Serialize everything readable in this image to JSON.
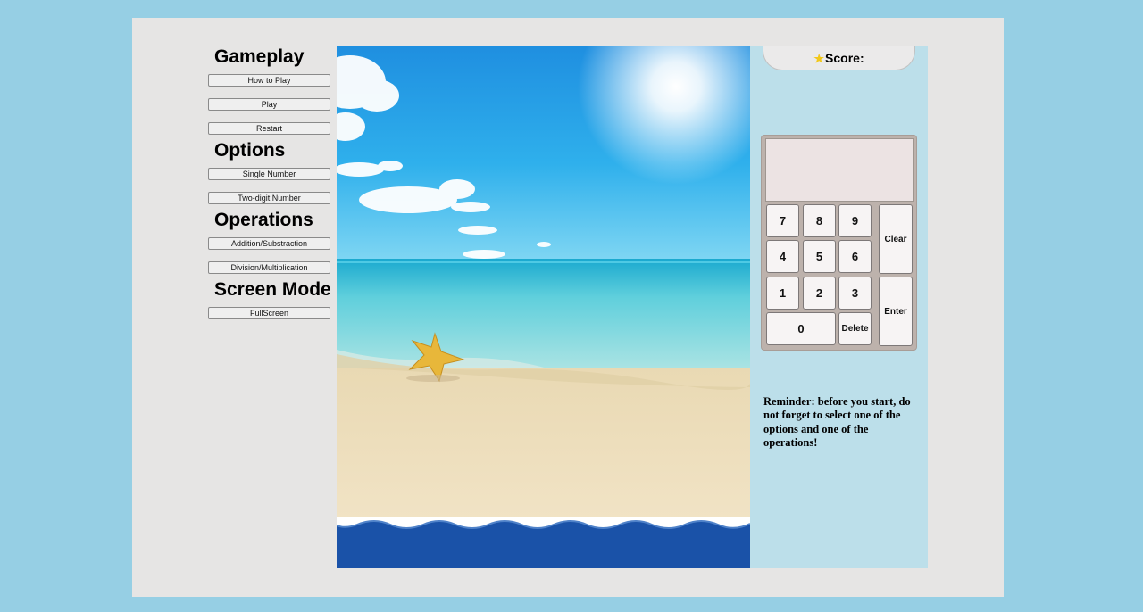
{
  "menu": {
    "gameplay_heading": "Gameplay",
    "how_to_play": "How to Play",
    "play": "Play",
    "restart": "Restart",
    "options_heading": "Options",
    "single_number": "Single Number",
    "two_digit_number": "Two-digit Number",
    "operations_heading": "Operations",
    "addition_subtraction": "Addition/Substraction",
    "division_multiplication": "Division/Multiplication",
    "screen_mode_heading": "Screen Mode",
    "fullscreen": "FullScreen"
  },
  "score": {
    "label": "Score:",
    "icon": "star-icon",
    "value": ""
  },
  "calculator": {
    "display_value": "",
    "keys": {
      "k7": "7",
      "k8": "8",
      "k9": "9",
      "k4": "4",
      "k5": "5",
      "k6": "6",
      "k1": "1",
      "k2": "2",
      "k3": "3",
      "k0": "0",
      "clear": "Clear",
      "enter": "Enter",
      "delete": "Delete"
    }
  },
  "reminder": "Reminder: before you start, do not forget to select one of the options and one of the operations!",
  "colors": {
    "page_background": "#96cfe4",
    "panel_background": "#e6e5e4",
    "game_column": "#bcdfea",
    "calculator_frame": "#bdb2ac",
    "sea_band": "#1a52a8"
  }
}
